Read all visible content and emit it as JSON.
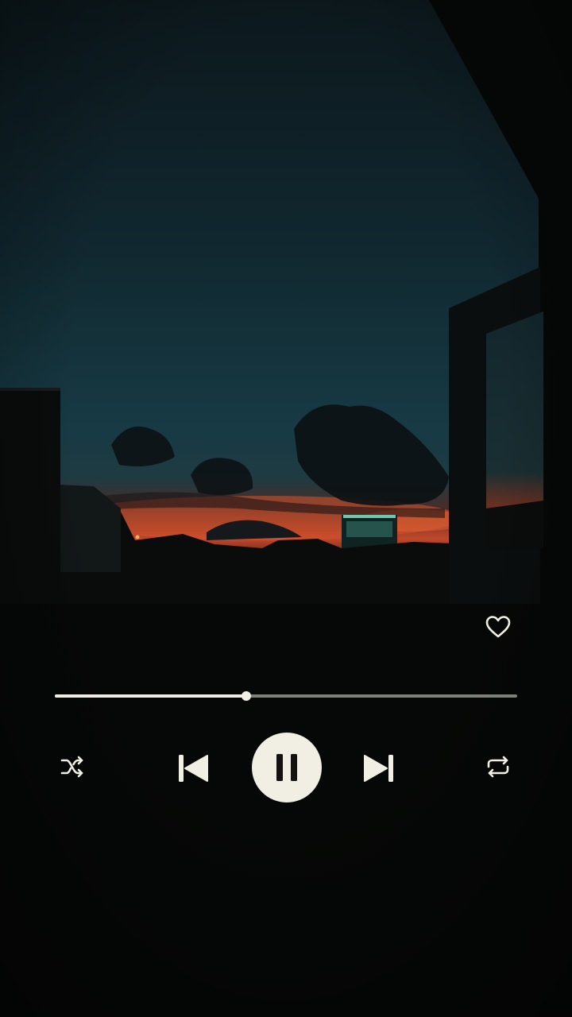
{
  "player": {
    "progress_fraction": 0.414,
    "is_playing": true,
    "liked": false
  },
  "icons": {
    "like": "heart-outline-icon",
    "shuffle": "shuffle-icon",
    "previous": "skip-previous-icon",
    "play_pause": "pause-icon",
    "next": "skip-next-icon",
    "repeat": "repeat-icon"
  },
  "colors": {
    "control": "#f1efe4",
    "track": "#7e817a",
    "pause_glyph": "#14120f",
    "sky_top": "#0c1a1e",
    "sunset": "#d9542b"
  }
}
